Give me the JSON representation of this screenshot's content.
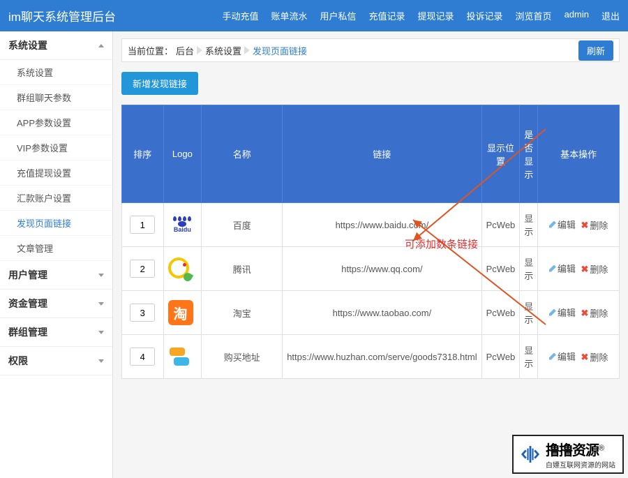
{
  "app_title": "im聊天系统管理后台",
  "topnav": [
    "手动充值",
    "账单流水",
    "用户私信",
    "充值记录",
    "提现记录",
    "投诉记录",
    "浏览首页",
    "admin",
    "退出"
  ],
  "sidebar": {
    "group0_title": "系统设置",
    "group0_items": [
      "系统设置",
      "群组聊天参数",
      "APP参数设置",
      "VIP参数设置",
      "充值提现设置",
      "汇款账户设置",
      "发现页面链接",
      "文章管理"
    ],
    "group0_active_index": 6,
    "group1_title": "用户管理",
    "group2_title": "资金管理",
    "group3_title": "群组管理",
    "group4_title": "权限"
  },
  "breadcrumb": {
    "prefix": "当前位置：",
    "c0": "后台",
    "c1": "系统设置",
    "c2": "发现页面链接",
    "refresh": "刷新"
  },
  "add_btn": "新增发现链接",
  "table": {
    "headers": {
      "sort": "排序",
      "logo": "Logo",
      "name": "名称",
      "link": "链接",
      "pos": "显示位置",
      "show": "是否显示",
      "ops": "基本操作"
    },
    "ops_edit": "编辑",
    "ops_delete": "删除",
    "rows": [
      {
        "sort": "1",
        "logo_id": "baidu",
        "name": "百度",
        "link": "https://www.baidu.com/",
        "pos": "PcWeb",
        "show": "显示"
      },
      {
        "sort": "2",
        "logo_id": "qq",
        "name": "腾讯",
        "link": "https://www.qq.com/",
        "pos": "PcWeb",
        "show": "显示"
      },
      {
        "sort": "3",
        "logo_id": "taobao",
        "name": "淘宝",
        "link": "https://www.taobao.com/",
        "pos": "PcWeb",
        "show": "显示"
      },
      {
        "sort": "4",
        "logo_id": "huzhan",
        "name": "购买地址",
        "link": "https://www.huzhan.com/serve/goods7318.html",
        "pos": "PcWeb",
        "show": "显示"
      }
    ]
  },
  "annotation": "可添加数条链接",
  "watermark": {
    "line1": "撸撸资源",
    "reg": "®",
    "line2": "白嫖互联网资源的网站"
  }
}
